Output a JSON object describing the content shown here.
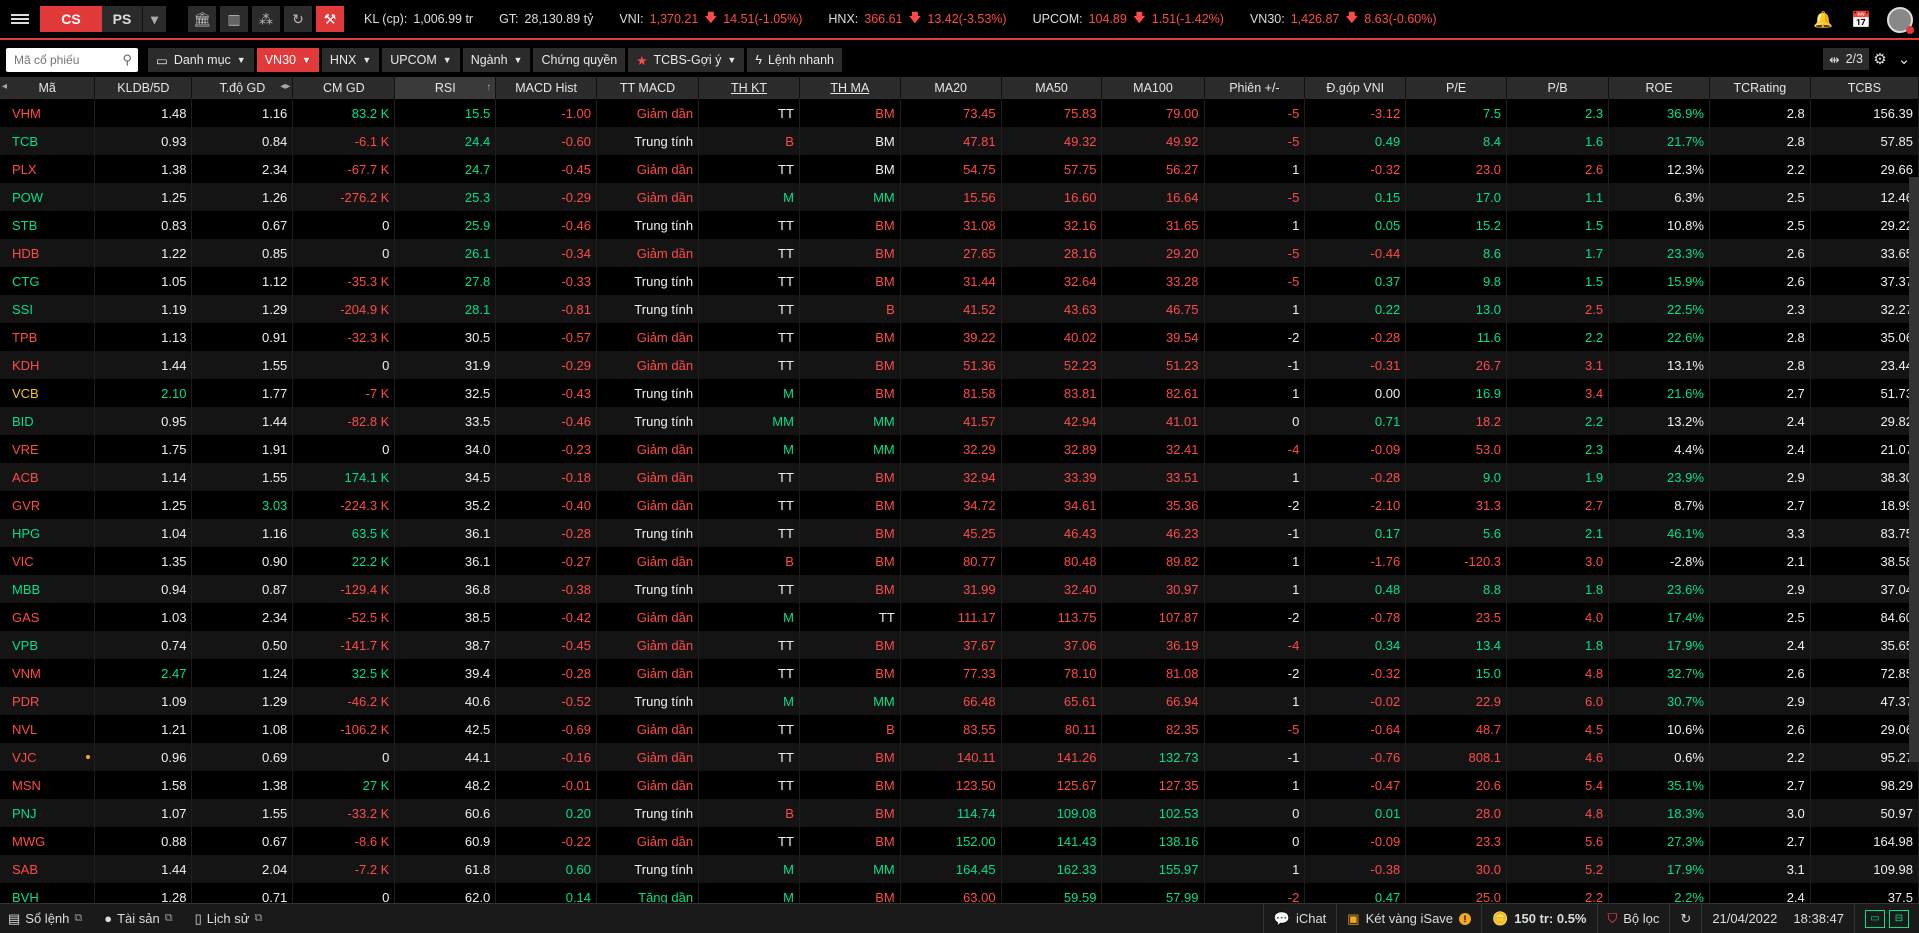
{
  "topbar": {
    "tab_cs": "CS",
    "tab_ps": "PS",
    "kl_label": "KL (cp):",
    "kl_value": "1,006.99 tr",
    "gt_label": "GT:",
    "gt_value": "28,130.89 tỷ",
    "indices": [
      {
        "name": "VNI:",
        "value": "1,370.21",
        "change": "14.51(-1.05%)"
      },
      {
        "name": "HNX:",
        "value": "366.61",
        "change": "13.42(-3.53%)"
      },
      {
        "name": "UPCOM:",
        "value": "104.89",
        "change": "1.51(-1.42%)"
      },
      {
        "name": "VN30:",
        "value": "1,426.87",
        "change": "8.63(-0.60%)"
      }
    ]
  },
  "filterbar": {
    "search_placeholder": "Mã cổ phiếu",
    "buttons": [
      "Danh mục",
      "VN30",
      "HNX",
      "UPCOM",
      "Ngành",
      "Chứng quyền",
      "TCBS-Gợi ý",
      "Lệnh nhanh"
    ],
    "pager": "2/3"
  },
  "table": {
    "headers": [
      "Mã",
      "KLDB/5D",
      "T.độ GD",
      "CM GD",
      "RSI",
      "MACD Hist",
      "TT MACD",
      "TH KT",
      "TH MA",
      "MA20",
      "MA50",
      "MA100",
      "Phiên +/-",
      "Đ.góp VNI",
      "P/E",
      "P/B",
      "ROE",
      "TCRating",
      "TCBS"
    ],
    "rows": [
      [
        "VHM",
        "1.48",
        "1.16",
        "83.2 K",
        "15.5",
        "-1.00",
        "Giảm dần",
        "TT",
        "BM",
        "73.45",
        "75.83",
        "79.00",
        "-5",
        "-3.12",
        "7.5",
        "2.3",
        "36.9%",
        "2.8",
        "156.39"
      ],
      [
        "TCB",
        "0.93",
        "0.84",
        "-6.1 K",
        "24.4",
        "-0.60",
        "Trung tính",
        "B",
        "BM",
        "47.81",
        "49.32",
        "49.92",
        "-5",
        "0.49",
        "8.4",
        "1.6",
        "21.7%",
        "2.8",
        "57.85"
      ],
      [
        "PLX",
        "1.38",
        "2.34",
        "-67.7 K",
        "24.7",
        "-0.45",
        "Giảm dần",
        "TT",
        "BM",
        "54.75",
        "57.75",
        "56.27",
        "1",
        "-0.32",
        "23.0",
        "2.6",
        "12.3%",
        "2.2",
        "29.66"
      ],
      [
        "POW",
        "1.25",
        "1.26",
        "-276.2 K",
        "25.3",
        "-0.29",
        "Giảm dần",
        "M",
        "MM",
        "15.56",
        "16.60",
        "16.64",
        "-5",
        "0.15",
        "17.0",
        "1.1",
        "6.3%",
        "2.5",
        "12.46"
      ],
      [
        "STB",
        "0.83",
        "0.67",
        "0",
        "25.9",
        "-0.46",
        "Trung tính",
        "TT",
        "BM",
        "31.08",
        "32.16",
        "31.65",
        "1",
        "0.05",
        "15.2",
        "1.5",
        "10.8%",
        "2.5",
        "29.22"
      ],
      [
        "HDB",
        "1.22",
        "0.85",
        "0",
        "26.1",
        "-0.34",
        "Giảm dần",
        "TT",
        "BM",
        "27.65",
        "28.16",
        "29.20",
        "-5",
        "-0.44",
        "8.6",
        "1.7",
        "23.3%",
        "2.6",
        "33.65"
      ],
      [
        "CTG",
        "1.05",
        "1.12",
        "-35.3 K",
        "27.8",
        "-0.33",
        "Trung tính",
        "TT",
        "BM",
        "31.44",
        "32.64",
        "33.28",
        "-5",
        "0.37",
        "9.8",
        "1.5",
        "15.9%",
        "2.6",
        "37.37"
      ],
      [
        "SSI",
        "1.19",
        "1.29",
        "-204.9 K",
        "28.1",
        "-0.81",
        "Trung tính",
        "TT",
        "B",
        "41.52",
        "43.63",
        "46.75",
        "1",
        "0.22",
        "13.0",
        "2.5",
        "22.5%",
        "2.3",
        "32.27"
      ],
      [
        "TPB",
        "1.13",
        "0.91",
        "-32.3 K",
        "30.5",
        "-0.57",
        "Giảm dần",
        "TT",
        "BM",
        "39.22",
        "40.02",
        "39.54",
        "-2",
        "-0.28",
        "11.6",
        "2.2",
        "22.6%",
        "2.8",
        "35.06"
      ],
      [
        "KDH",
        "1.44",
        "1.55",
        "0",
        "31.9",
        "-0.29",
        "Giảm dần",
        "TT",
        "BM",
        "51.36",
        "52.23",
        "51.23",
        "-1",
        "-0.31",
        "26.7",
        "3.1",
        "13.1%",
        "2.8",
        "23.44"
      ],
      [
        "VCB",
        "2.10",
        "1.77",
        "-7 K",
        "32.5",
        "-0.43",
        "Trung tính",
        "M",
        "BM",
        "81.58",
        "83.81",
        "82.61",
        "1",
        "0.00",
        "16.9",
        "3.4",
        "21.6%",
        "2.7",
        "51.73"
      ],
      [
        "BID",
        "0.95",
        "1.44",
        "-82.8 K",
        "33.5",
        "-0.46",
        "Trung tính",
        "MM",
        "MM",
        "41.57",
        "42.94",
        "41.01",
        "0",
        "0.71",
        "18.2",
        "2.2",
        "13.2%",
        "2.4",
        "29.82"
      ],
      [
        "VRE",
        "1.75",
        "1.91",
        "0",
        "34.0",
        "-0.23",
        "Giảm dần",
        "M",
        "MM",
        "32.29",
        "32.89",
        "32.41",
        "-4",
        "-0.09",
        "53.0",
        "2.3",
        "4.4%",
        "2.4",
        "21.07"
      ],
      [
        "ACB",
        "1.14",
        "1.55",
        "174.1 K",
        "34.5",
        "-0.18",
        "Giảm dần",
        "TT",
        "BM",
        "32.94",
        "33.39",
        "33.51",
        "1",
        "-0.28",
        "9.0",
        "1.9",
        "23.9%",
        "2.9",
        "38.30"
      ],
      [
        "GVR",
        "1.25",
        "3.03",
        "-224.3 K",
        "35.2",
        "-0.40",
        "Giảm dần",
        "TT",
        "BM",
        "34.72",
        "34.61",
        "35.36",
        "-2",
        "-2.10",
        "31.3",
        "2.7",
        "8.7%",
        "2.7",
        "18.99"
      ],
      [
        "HPG",
        "1.04",
        "1.16",
        "63.5 K",
        "36.1",
        "-0.28",
        "Trung tính",
        "TT",
        "BM",
        "45.25",
        "46.43",
        "46.23",
        "-1",
        "0.17",
        "5.6",
        "2.1",
        "46.1%",
        "3.3",
        "83.75"
      ],
      [
        "VIC",
        "1.35",
        "0.90",
        "22.2 K",
        "36.1",
        "-0.27",
        "Giảm dần",
        "B",
        "BM",
        "80.77",
        "80.48",
        "89.82",
        "1",
        "-1.76",
        "-120.3",
        "3.0",
        "-2.8%",
        "2.1",
        "38.58"
      ],
      [
        "MBB",
        "0.94",
        "0.87",
        "-129.4 K",
        "36.8",
        "-0.38",
        "Trung tính",
        "TT",
        "BM",
        "31.99",
        "32.40",
        "30.97",
        "1",
        "0.48",
        "8.8",
        "1.8",
        "23.6%",
        "2.9",
        "37.04"
      ],
      [
        "GAS",
        "1.03",
        "2.34",
        "-52.5 K",
        "38.5",
        "-0.42",
        "Giảm dần",
        "M",
        "TT",
        "111.17",
        "113.75",
        "107.87",
        "-2",
        "-0.78",
        "23.5",
        "4.0",
        "17.4%",
        "2.5",
        "84.60"
      ],
      [
        "VPB",
        "0.74",
        "0.50",
        "-141.7 K",
        "38.7",
        "-0.45",
        "Giảm dần",
        "TT",
        "BM",
        "37.67",
        "37.06",
        "36.19",
        "-4",
        "0.34",
        "13.4",
        "1.8",
        "17.9%",
        "2.4",
        "35.65"
      ],
      [
        "VNM",
        "2.47",
        "1.24",
        "32.5 K",
        "39.4",
        "-0.28",
        "Giảm dần",
        "TT",
        "BM",
        "77.33",
        "78.10",
        "81.08",
        "-2",
        "-0.32",
        "15.0",
        "4.8",
        "32.7%",
        "2.6",
        "72.85"
      ],
      [
        "PDR",
        "1.09",
        "1.29",
        "-46.2 K",
        "40.6",
        "-0.52",
        "Trung tính",
        "M",
        "MM",
        "66.48",
        "65.61",
        "66.94",
        "1",
        "-0.02",
        "22.9",
        "6.0",
        "30.7%",
        "2.9",
        "47.37"
      ],
      [
        "NVL",
        "1.21",
        "1.08",
        "-106.2 K",
        "42.5",
        "-0.69",
        "Giảm dần",
        "TT",
        "B",
        "83.55",
        "80.11",
        "82.35",
        "-5",
        "-0.64",
        "48.7",
        "4.5",
        "10.6%",
        "2.6",
        "29.06"
      ],
      [
        "VJC",
        "0.96",
        "0.69",
        "0",
        "44.1",
        "-0.16",
        "Giảm dần",
        "TT",
        "BM",
        "140.11",
        "141.26",
        "132.73",
        "-1",
        "-0.76",
        "808.1",
        "4.6",
        "0.6%",
        "2.2",
        "95.27"
      ],
      [
        "MSN",
        "1.58",
        "1.38",
        "27 K",
        "48.2",
        "-0.01",
        "Giảm dần",
        "TT",
        "BM",
        "123.50",
        "125.67",
        "127.35",
        "1",
        "-0.47",
        "20.6",
        "5.4",
        "35.1%",
        "2.7",
        "98.29"
      ],
      [
        "PNJ",
        "1.07",
        "1.55",
        "-33.2 K",
        "60.6",
        "0.20",
        "Trung tính",
        "B",
        "BM",
        "114.74",
        "109.08",
        "102.53",
        "0",
        "0.01",
        "28.0",
        "4.8",
        "18.3%",
        "3.0",
        "50.97"
      ],
      [
        "MWG",
        "0.88",
        "0.67",
        "-8.6 K",
        "60.9",
        "-0.22",
        "Giảm dần",
        "TT",
        "BM",
        "152.00",
        "141.43",
        "138.16",
        "0",
        "-0.09",
        "23.3",
        "5.6",
        "27.3%",
        "2.7",
        "164.98"
      ],
      [
        "SAB",
        "1.44",
        "2.04",
        "-7.2 K",
        "61.8",
        "0.60",
        "Trung tính",
        "M",
        "MM",
        "164.45",
        "162.33",
        "155.97",
        "1",
        "-0.38",
        "30.0",
        "5.2",
        "17.9%",
        "3.1",
        "109.98"
      ],
      [
        "BVH",
        "1.28",
        "0.71",
        "0",
        "62.0",
        "0.14",
        "Tăng dần",
        "M",
        "BM",
        "63.00",
        "59.59",
        "57.99",
        "-2",
        "0.47",
        "25.0",
        "2.2",
        "2.2%",
        "2.4",
        "37.5"
      ]
    ],
    "colors": [
      [
        "r",
        "w",
        "w",
        "g",
        "g",
        "r",
        "r",
        "w",
        "r",
        "r",
        "r",
        "r",
        "r",
        "r",
        "g",
        "g",
        "g",
        "w",
        "w"
      ],
      [
        "g",
        "w",
        "w",
        "r",
        "g",
        "r",
        "w",
        "r",
        "w",
        "r",
        "r",
        "r",
        "r",
        "g",
        "g",
        "g",
        "g",
        "w",
        "w"
      ],
      [
        "r",
        "w",
        "w",
        "r",
        "g",
        "r",
        "r",
        "w",
        "w",
        "r",
        "r",
        "r",
        "w",
        "r",
        "r",
        "r",
        "w",
        "w",
        "w"
      ],
      [
        "g",
        "w",
        "w",
        "r",
        "g",
        "r",
        "r",
        "g",
        "g",
        "r",
        "r",
        "r",
        "r",
        "g",
        "g",
        "g",
        "w",
        "w",
        "w"
      ],
      [
        "g",
        "w",
        "w",
        "w",
        "g",
        "r",
        "w",
        "w",
        "r",
        "r",
        "r",
        "r",
        "w",
        "g",
        "g",
        "g",
        "w",
        "w",
        "w"
      ],
      [
        "r",
        "w",
        "w",
        "w",
        "g",
        "r",
        "r",
        "w",
        "r",
        "r",
        "r",
        "r",
        "r",
        "r",
        "g",
        "g",
        "g",
        "w",
        "w"
      ],
      [
        "g",
        "w",
        "w",
        "r",
        "g",
        "r",
        "w",
        "w",
        "r",
        "r",
        "r",
        "r",
        "r",
        "g",
        "g",
        "g",
        "g",
        "w",
        "w"
      ],
      [
        "g",
        "w",
        "w",
        "r",
        "g",
        "r",
        "w",
        "w",
        "r",
        "r",
        "r",
        "r",
        "w",
        "g",
        "g",
        "r",
        "g",
        "w",
        "w"
      ],
      [
        "r",
        "w",
        "w",
        "r",
        "w",
        "r",
        "r",
        "w",
        "r",
        "r",
        "r",
        "r",
        "w",
        "r",
        "g",
        "g",
        "g",
        "w",
        "w"
      ],
      [
        "r",
        "w",
        "w",
        "w",
        "w",
        "r",
        "r",
        "w",
        "r",
        "r",
        "r",
        "r",
        "w",
        "r",
        "r",
        "r",
        "w",
        "w",
        "w"
      ],
      [
        "y",
        "g",
        "w",
        "r",
        "w",
        "r",
        "w",
        "g",
        "r",
        "r",
        "r",
        "r",
        "w",
        "w",
        "g",
        "r",
        "g",
        "w",
        "w"
      ],
      [
        "g",
        "w",
        "w",
        "r",
        "w",
        "r",
        "w",
        "g",
        "g",
        "r",
        "r",
        "r",
        "w",
        "g",
        "r",
        "g",
        "w",
        "w",
        "w"
      ],
      [
        "r",
        "w",
        "w",
        "w",
        "w",
        "r",
        "r",
        "g",
        "g",
        "r",
        "r",
        "r",
        "r",
        "r",
        "r",
        "g",
        "w",
        "w",
        "w"
      ],
      [
        "r",
        "w",
        "w",
        "g",
        "w",
        "r",
        "r",
        "w",
        "r",
        "r",
        "r",
        "r",
        "w",
        "r",
        "g",
        "g",
        "g",
        "w",
        "w"
      ],
      [
        "r",
        "w",
        "g",
        "r",
        "w",
        "r",
        "r",
        "w",
        "r",
        "r",
        "r",
        "r",
        "w",
        "r",
        "r",
        "r",
        "w",
        "w",
        "w"
      ],
      [
        "g",
        "w",
        "w",
        "g",
        "w",
        "r",
        "w",
        "w",
        "r",
        "r",
        "r",
        "r",
        "w",
        "g",
        "g",
        "g",
        "g",
        "w",
        "w"
      ],
      [
        "r",
        "w",
        "w",
        "g",
        "w",
        "r",
        "r",
        "r",
        "r",
        "r",
        "r",
        "r",
        "w",
        "r",
        "r",
        "r",
        "w",
        "w",
        "w"
      ],
      [
        "g",
        "w",
        "w",
        "r",
        "w",
        "r",
        "w",
        "w",
        "r",
        "r",
        "r",
        "r",
        "w",
        "g",
        "g",
        "g",
        "g",
        "w",
        "w"
      ],
      [
        "r",
        "w",
        "w",
        "r",
        "w",
        "r",
        "r",
        "g",
        "w",
        "r",
        "r",
        "r",
        "w",
        "r",
        "r",
        "r",
        "g",
        "w",
        "w"
      ],
      [
        "g",
        "w",
        "w",
        "r",
        "w",
        "r",
        "r",
        "w",
        "r",
        "r",
        "r",
        "r",
        "r",
        "g",
        "g",
        "g",
        "g",
        "w",
        "w"
      ],
      [
        "r",
        "g",
        "w",
        "g",
        "w",
        "r",
        "r",
        "w",
        "r",
        "r",
        "r",
        "r",
        "w",
        "r",
        "g",
        "r",
        "g",
        "w",
        "w"
      ],
      [
        "r",
        "w",
        "w",
        "r",
        "w",
        "r",
        "w",
        "g",
        "g",
        "r",
        "r",
        "r",
        "w",
        "r",
        "r",
        "r",
        "g",
        "w",
        "w"
      ],
      [
        "r",
        "w",
        "w",
        "r",
        "w",
        "r",
        "r",
        "w",
        "r",
        "r",
        "r",
        "r",
        "r",
        "r",
        "r",
        "r",
        "w",
        "w",
        "w"
      ],
      [
        "r",
        "w",
        "w",
        "w",
        "w",
        "r",
        "r",
        "w",
        "r",
        "r",
        "r",
        "g",
        "w",
        "r",
        "r",
        "r",
        "w",
        "w",
        "w"
      ],
      [
        "r",
        "w",
        "w",
        "g",
        "w",
        "r",
        "r",
        "w",
        "r",
        "r",
        "r",
        "r",
        "w",
        "r",
        "r",
        "r",
        "g",
        "w",
        "w"
      ],
      [
        "g",
        "w",
        "w",
        "r",
        "w",
        "g",
        "w",
        "r",
        "r",
        "g",
        "g",
        "g",
        "w",
        "g",
        "r",
        "r",
        "g",
        "w",
        "w"
      ],
      [
        "r",
        "w",
        "w",
        "r",
        "w",
        "r",
        "r",
        "w",
        "r",
        "g",
        "g",
        "g",
        "w",
        "r",
        "r",
        "r",
        "g",
        "w",
        "w"
      ],
      [
        "r",
        "w",
        "w",
        "r",
        "w",
        "g",
        "w",
        "g",
        "g",
        "g",
        "g",
        "g",
        "w",
        "r",
        "r",
        "r",
        "g",
        "w",
        "w"
      ],
      [
        "g",
        "w",
        "w",
        "w",
        "w",
        "g",
        "g",
        "g",
        "r",
        "r",
        "g",
        "g",
        "r",
        "g",
        "r",
        "r",
        "g",
        "w",
        "w"
      ]
    ],
    "dot_rows": [
      23
    ]
  },
  "bottombar": {
    "so_lenh": "Sổ lệnh",
    "tai_san": "Tài sản",
    "lich_su": "Lịch sử",
    "ichat": "iChat",
    "isave": "Két vàng iSave",
    "rate": "150 tr: 0.5%",
    "bo_loc": "Bộ lọc",
    "date": "21/04/2022",
    "time": "18:38:47"
  },
  "colors": {
    "accent": "#e23a3a",
    "up": "#00e08a",
    "down": "#ff4a4a",
    "ref": "#f5c518"
  }
}
